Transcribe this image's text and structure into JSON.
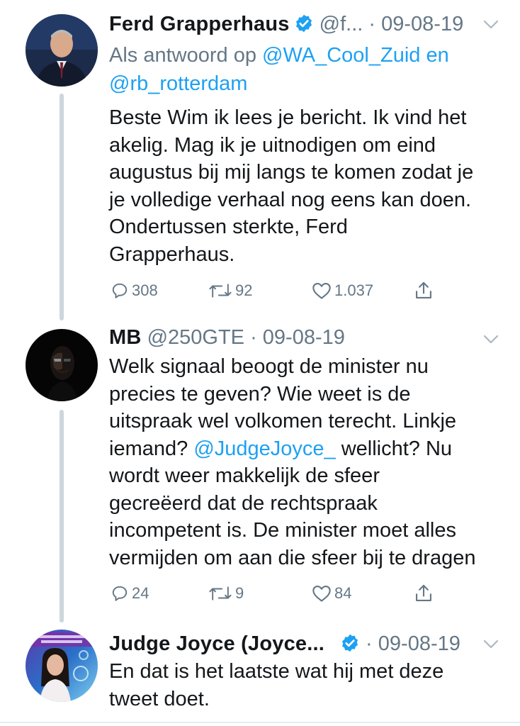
{
  "tweets": [
    {
      "name": "Ferd Grapperhaus",
      "handle": "@f...",
      "separator": " · ",
      "date": "09-08-19",
      "verified": true,
      "reply_prefix": "Als antwoord op ",
      "reply_mention_1": "@WA_Cool_Zuid",
      "reply_joiner": " en",
      "reply_mention_2": "@rb_rotterdam",
      "text": "Beste Wim ik lees je bericht. Ik vind het\nakelig. Mag ik je uitnodigen om eind\naugustus bij mij langs te komen zodat je\nje volledige verhaal nog eens kan doen.\nOndertussen sterkte, Ferd\nGrapperhaus.",
      "replies": "308",
      "retweets": "92",
      "likes": "1.037",
      "avatar_icon": "person-portrait-suit"
    },
    {
      "name": "MB",
      "handle": " @250GTE",
      "separator": " · ",
      "date": "09-08-19",
      "verified": false,
      "text_part_1": "Welk signaal beoogt de minister nu\nprecies te geven? Wie weet is de\nuitspraak wel volkomen terecht. Linkje\niemand? ",
      "text_mention": "@JudgeJoyce_",
      "text_part_2": " wellicht? Nu\nwordt weer makkelijk de sfeer\ngecreëerd dat de rechtspraak\nincompetent is. De minister moet alles\nvermijden om aan die sfeer bij te dragen",
      "replies": "24",
      "retweets": "9",
      "likes": "84",
      "avatar_icon": "dark-masked-face"
    },
    {
      "name": "Judge Joyce (Joyce...",
      "handle": "",
      "separator": " · ",
      "date": "09-08-19",
      "verified": true,
      "text": "En dat is het laatste wat hij met deze\ntweet doet.",
      "avatar_icon": "woman-portrait-blue-purple"
    }
  ],
  "colors": {
    "text": "#14171a",
    "secondary": "#657786",
    "link": "#1da1f2",
    "thread_line": "#ccd6dd",
    "verified_badge": "#1da1f2"
  },
  "icons": {
    "reply": "reply-icon",
    "retweet": "retweet-icon",
    "like": "heart-icon",
    "share": "share-icon",
    "caret": "chevron-down-icon",
    "verified": "verified-badge-icon"
  }
}
